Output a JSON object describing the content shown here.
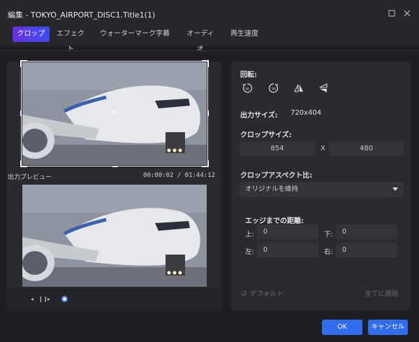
{
  "window": {
    "title": "編集 - TOKYO_AIRPORT_DISC1.Title1(1)",
    "maximize_icon": "maximize-icon",
    "close_icon": "close-icon"
  },
  "tabs": [
    {
      "label": "クロップ",
      "active": true
    },
    {
      "label": "エフェクト",
      "active": false
    },
    {
      "label": "ウォーターマーク",
      "active": false
    },
    {
      "label": "字幕",
      "active": false
    },
    {
      "label": "オーディオ",
      "active": false
    },
    {
      "label": "再生速度",
      "active": false
    }
  ],
  "preview": {
    "output_label": "出力プレビュー",
    "timecode": "00:00:02 / 01:44:12",
    "controls": {
      "prev_icon": "previous-frame-icon",
      "play_pause_icon": "play-pause-icon",
      "next_icon": "next-frame-icon"
    }
  },
  "settings": {
    "rotation_label": "回転:",
    "rotation_buttons": [
      "rotate-left-90-icon",
      "rotate-right-90-icon",
      "flip-horizontal-icon",
      "flip-vertical-icon"
    ],
    "output_size_label": "出力サイズ:",
    "output_size_value": "720x404",
    "crop_size_label": "クロップサイズ:",
    "crop_width": "854",
    "crop_height": "480",
    "crop_separator": "X",
    "aspect_label": "クロップアスペクト比:",
    "aspect_value": "オリジナルを維持",
    "edge_label": "エッジまでの距離:",
    "edge": {
      "top_label": "上:",
      "top_value": "0",
      "bottom_label": "下:",
      "bottom_value": "0",
      "left_label": "左:",
      "left_value": "0",
      "right_label": "右:",
      "right_value": "0"
    },
    "default_label": "デフォルト",
    "apply_all_label": "全てに適用"
  },
  "buttons": {
    "ok": "OK",
    "cancel": "キャンセル"
  },
  "colors": {
    "accent": "#2f6cf2",
    "tab_active_start": "#6a2ee8",
    "tab_active_end": "#3c4ef0",
    "background": "#1e1f23",
    "panel": "#2a2b30"
  }
}
